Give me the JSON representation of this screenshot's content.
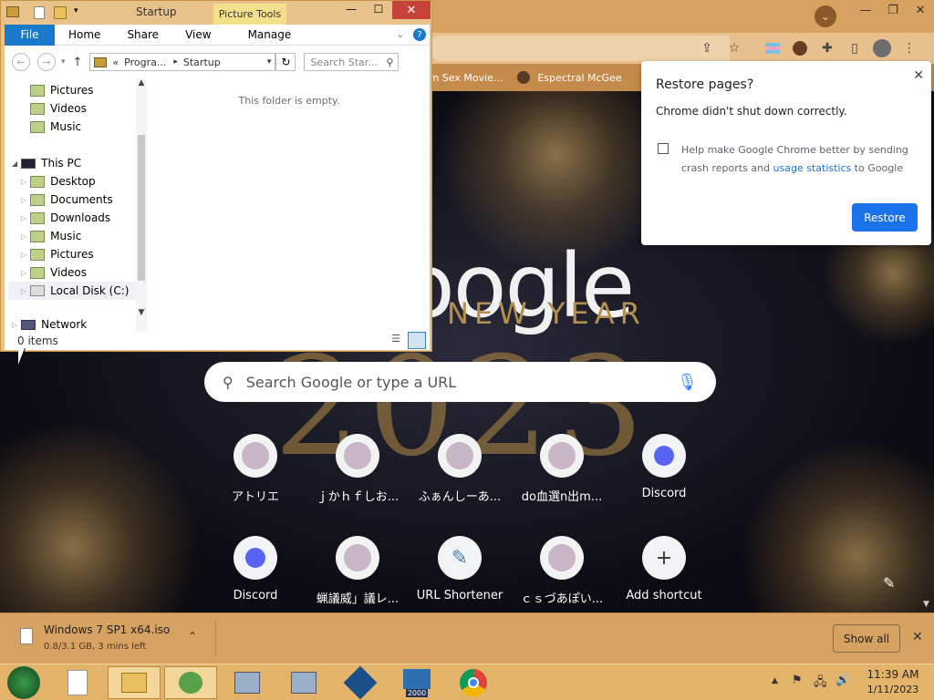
{
  "chrome": {
    "bookmarks": [
      "rn Sex Movie...",
      "Espectral McGee"
    ],
    "search_placeholder": "Search Google or type a URL",
    "logo": "oogle",
    "logo_sub": "NEW YEAR",
    "logo_year": "2023",
    "shortcuts": [
      {
        "label": "アトリエ",
        "icon": "avatar-icon"
      },
      {
        "label": "ｊかｈｆしお...",
        "icon": "avatar-icon"
      },
      {
        "label": "ふぁんしーあ...",
        "icon": "avatar-icon"
      },
      {
        "label": "do血選n出m...",
        "icon": "avatar-icon"
      },
      {
        "label": "Discord",
        "icon": "discord-icon"
      },
      {
        "label": "Discord",
        "icon": "discord-icon"
      },
      {
        "label": "蝋議威」議レ...",
        "icon": "avatar-icon"
      },
      {
        "label": "URL Shortener",
        "icon": "pen-icon"
      },
      {
        "label": "ｃｓづあぽい...",
        "icon": "avatar-icon"
      },
      {
        "label": "Add shortcut",
        "icon": "plus-icon"
      }
    ]
  },
  "restore": {
    "title": "Restore pages?",
    "message": "Chrome didn't shut down correctly.",
    "checkbox_text_1": "Help make Google Chrome better by sending",
    "checkbox_text_2a": "crash reports and ",
    "checkbox_link": "usage statistics",
    "checkbox_text_2b": " to Google",
    "button": "Restore"
  },
  "explorer": {
    "title": "Startup",
    "context_tab": "Picture Tools",
    "tabs": [
      "File",
      "Home",
      "Share",
      "View",
      "Manage"
    ],
    "address_prefix": "«",
    "address": [
      "Progra...",
      "Startup"
    ],
    "search_placeholder": "Search Star...",
    "empty_text": "This folder is empty.",
    "status": "0 items",
    "nav_items": [
      {
        "label": "Pictures",
        "level": 1
      },
      {
        "label": "Videos",
        "level": 1
      },
      {
        "label": "Music",
        "level": 1
      },
      {
        "label": "This PC",
        "level": 0
      },
      {
        "label": "Desktop",
        "level": 1
      },
      {
        "label": "Documents",
        "level": 1
      },
      {
        "label": "Downloads",
        "level": 1
      },
      {
        "label": "Music",
        "level": 1
      },
      {
        "label": "Pictures",
        "level": 1
      },
      {
        "label": "Videos",
        "level": 1
      },
      {
        "label": "Local Disk (C:)",
        "level": 1
      },
      {
        "label": "Network",
        "level": 0
      }
    ]
  },
  "download": {
    "filename": "Windows 7 SP1 x64.iso",
    "progress": "0.8/3.1 GB, 3 mins left",
    "show_all": "Show all"
  },
  "taskbar": {
    "time": "11:39 AM",
    "date": "1/11/2023",
    "vbox_label": "2000"
  }
}
